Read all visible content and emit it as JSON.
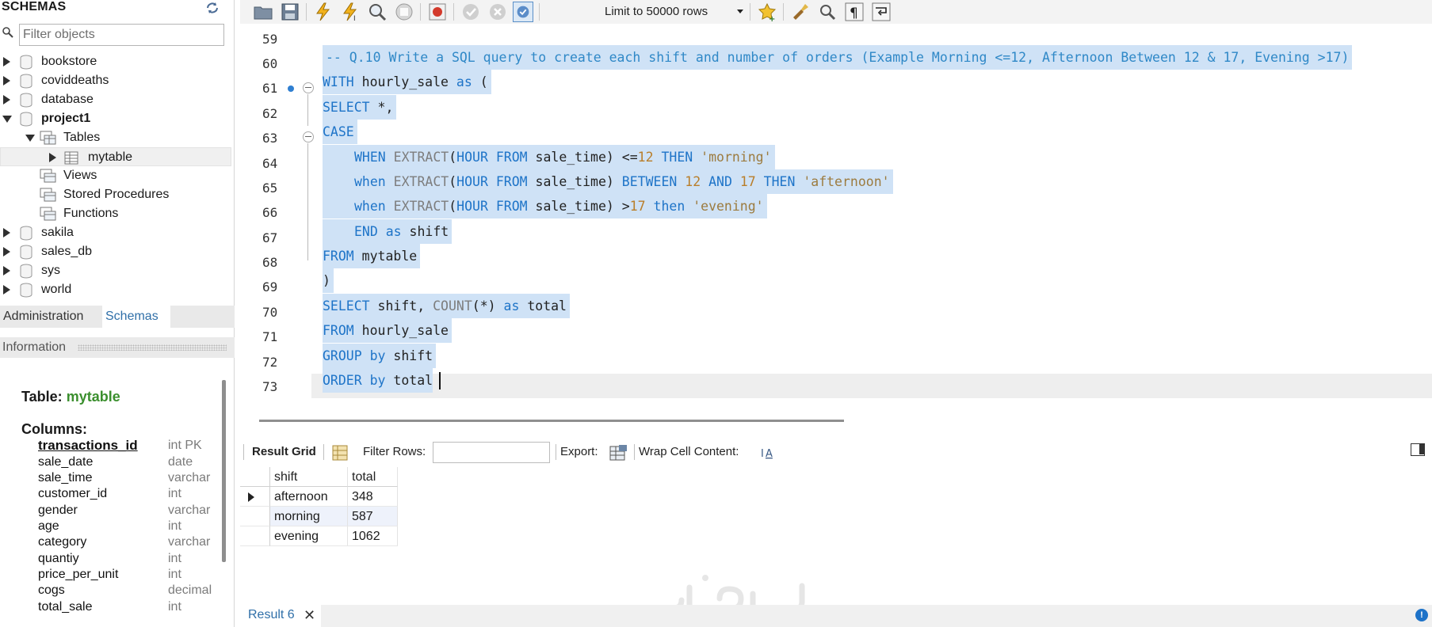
{
  "sidebar": {
    "title": "SCHEMAS",
    "filter_placeholder": "Filter objects",
    "schemas": [
      {
        "name": "bookstore"
      },
      {
        "name": "coviddeaths"
      },
      {
        "name": "database"
      },
      {
        "name": "project1"
      },
      {
        "name": "sakila"
      },
      {
        "name": "sales_db"
      },
      {
        "name": "sys"
      },
      {
        "name": "world"
      }
    ],
    "project1_children": {
      "tables_label": "Tables",
      "table_item": "mytable",
      "views_label": "Views",
      "procedures_label": "Stored Procedures",
      "functions_label": "Functions"
    },
    "tabs": {
      "admin": "Administration",
      "schemas": "Schemas"
    },
    "info_header": "Information",
    "info": {
      "table_prefix": "Table:",
      "table_name": "mytable",
      "columns_label": "Columns:",
      "columns": [
        {
          "name": "transactions_id",
          "type": "int PK"
        },
        {
          "name": "sale_date",
          "type": "date"
        },
        {
          "name": "sale_time",
          "type": "varchar"
        },
        {
          "name": "customer_id",
          "type": "int"
        },
        {
          "name": "gender",
          "type": "varchar"
        },
        {
          "name": "age",
          "type": "int"
        },
        {
          "name": "category",
          "type": "varchar"
        },
        {
          "name": "quantiy",
          "type": "int"
        },
        {
          "name": "price_per_unit",
          "type": "int"
        },
        {
          "name": "cogs",
          "type": "decimal"
        },
        {
          "name": "total_sale",
          "type": "int"
        }
      ]
    }
  },
  "toolbar": {
    "limit_label": "Limit to 50000 rows"
  },
  "editor": {
    "line_numbers": [
      "59",
      "60",
      "61",
      "62",
      "63",
      "64",
      "65",
      "66",
      "67",
      "68",
      "69",
      "70",
      "71",
      "72",
      "73"
    ],
    "lines": {
      "l60": "-- Q.10 Write a SQL query to create each shift and number of orders (Example Morning <=12, Afternoon Between 12 & 17, Evening >17)",
      "l61a": "WITH",
      "l61b": " hourly_sale ",
      "l61c": "as",
      "l61d": " (",
      "l62a": "SELECT",
      "l62b": " *,",
      "l63a": "CASE",
      "l64a": "WHEN",
      "l64b": " EXTRACT",
      "l64c": "(",
      "l64d": "HOUR FROM",
      "l64e": " sale_time) <=",
      "l64f": "12",
      "l64g": " THEN",
      "l64h": " 'morning'",
      "l65a": "when",
      "l65b": " EXTRACT",
      "l65c": "(",
      "l65d": "HOUR FROM",
      "l65e": " sale_time) ",
      "l65f": "BETWEEN",
      "l65g": " 12",
      "l65h": " AND",
      "l65i": " 17",
      "l65j": " THEN",
      "l65k": " 'afternoon'",
      "l66a": "when",
      "l66b": " EXTRACT",
      "l66c": "(",
      "l66d": "HOUR FROM",
      "l66e": " sale_time) >",
      "l66f": "17",
      "l66g": " then",
      "l66h": " 'evening'",
      "l67a": "END",
      "l67b": " as",
      "l67c": " shift",
      "l68a": "FROM",
      "l68b": " mytable",
      "l69a": ")",
      "l70a": "SELECT",
      "l70b": " shift, ",
      "l70c": "COUNT",
      "l70d": "(*) ",
      "l70e": "as",
      "l70f": " total",
      "l71a": "FROM",
      "l71b": " hourly_sale",
      "l72a": "GROUP by",
      "l72b": " shift",
      "l73a": "ORDER by",
      "l73b": " total"
    }
  },
  "result_toolbar": {
    "grid_label": "Result Grid",
    "filter_label": "Filter Rows:",
    "export_label": "Export:",
    "wrap_label": "Wrap Cell Content:"
  },
  "results": {
    "columns": [
      "shift",
      "total"
    ],
    "rows": [
      {
        "shift": "afternoon",
        "total": "348"
      },
      {
        "shift": "morning",
        "total": "587"
      },
      {
        "shift": "evening",
        "total": "1062"
      }
    ]
  },
  "bottom": {
    "result_tab": "Result 6",
    "close_glyph": "✕"
  },
  "colors": {
    "keyword": "#1e74c8",
    "selection": "#cfe2f6",
    "table_name": "#3b8f2e"
  }
}
